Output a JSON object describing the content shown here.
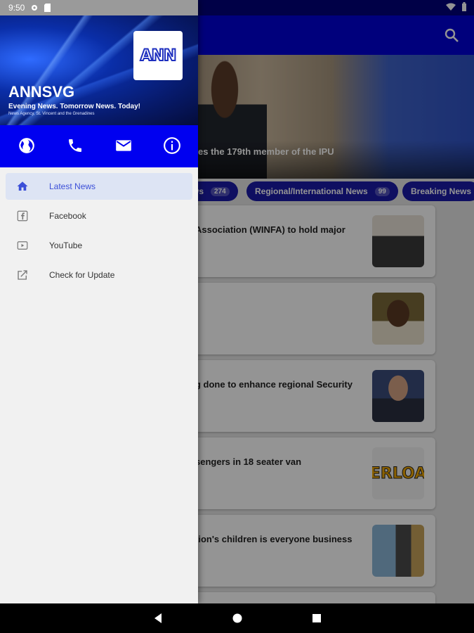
{
  "status_bar": {
    "time": "9:50"
  },
  "drawer": {
    "logo_text": "ANN",
    "brand": "ANNSVG",
    "tagline": "Evening News. Tomorrow News. Today!",
    "subtagline": "News Agency, St. Vincent and the Grenadines",
    "actions": [
      {
        "name": "website",
        "icon": "globe-icon"
      },
      {
        "name": "call",
        "icon": "phone-icon"
      },
      {
        "name": "email",
        "icon": "mail-icon"
      },
      {
        "name": "about",
        "icon": "info-icon"
      }
    ],
    "menu": [
      {
        "label": "Latest News",
        "icon": "home-icon",
        "active": true
      },
      {
        "label": "Facebook",
        "icon": "facebook-icon",
        "active": false
      },
      {
        "label": "YouTube",
        "icon": "youtube-icon",
        "active": false
      },
      {
        "label": "Check for Update",
        "icon": "open-external-icon",
        "active": false
      }
    ],
    "colors": {
      "accent": "#0000f0",
      "active_text": "#3b4fd8",
      "active_bg": "#dde4f4"
    }
  },
  "main": {
    "hero_title": "es the 179th member of the IPU",
    "chips": [
      {
        "label": "ws",
        "count": "274"
      },
      {
        "label": "Regional/International News",
        "count": "99"
      },
      {
        "label": "Breaking News",
        "count": ""
      }
    ],
    "cards": [
      {
        "title": "Association (WINFA) to hold major"
      },
      {
        "title": ""
      },
      {
        "title": "g done to enhance regional Security"
      },
      {
        "title": "sengers in 18 seater van",
        "thumb_text": "ERLOA"
      },
      {
        "title": "tion's children is everyone business"
      }
    ],
    "colors": {
      "appbar": "#0000d6",
      "chip": "#1a1aa8"
    }
  }
}
